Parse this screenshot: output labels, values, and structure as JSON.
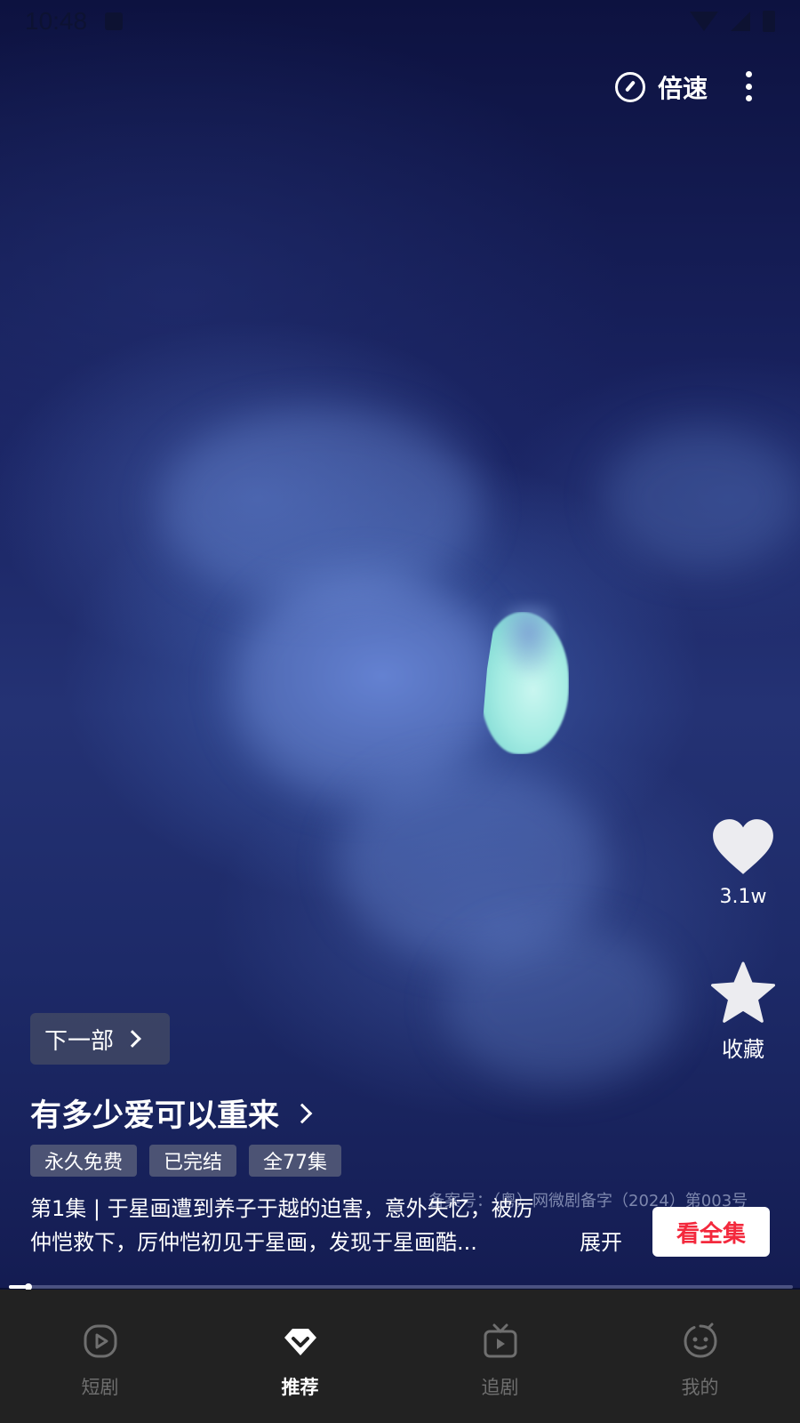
{
  "status_bar": {
    "time": "10:48"
  },
  "top_controls": {
    "speed_label": "倍速"
  },
  "actions": {
    "like_count": "3.1w",
    "favorite_label": "收藏"
  },
  "next_part": {
    "label": "下一部"
  },
  "drama": {
    "title": "有多少爱可以重来",
    "tags": [
      "永久免费",
      "已完结",
      "全77集"
    ],
    "synopsis_line1": "第1集 | 于星画遭到养子于越的迫害，意外失忆，被厉",
    "synopsis_line2": "仲恺救下，厉仲恺初见于星画，发现于星画酷...",
    "expand_label": "展开",
    "registration": "备案号：（粤）网微剧备字（2024）第003号",
    "watch_all_label": "看全集"
  },
  "playback": {
    "progress": 0.025
  },
  "bottom_nav": {
    "items": [
      {
        "label": "短剧",
        "icon": "play-circle-icon",
        "active": false
      },
      {
        "label": "推荐",
        "icon": "diamond-icon",
        "active": true
      },
      {
        "label": "追剧",
        "icon": "tv-icon",
        "active": false
      },
      {
        "label": "我的",
        "icon": "face-icon",
        "active": false
      }
    ]
  },
  "colors": {
    "accent_red": "#f3293d",
    "nav_bg": "#222222",
    "inactive_nav": "#6f6f6f"
  }
}
